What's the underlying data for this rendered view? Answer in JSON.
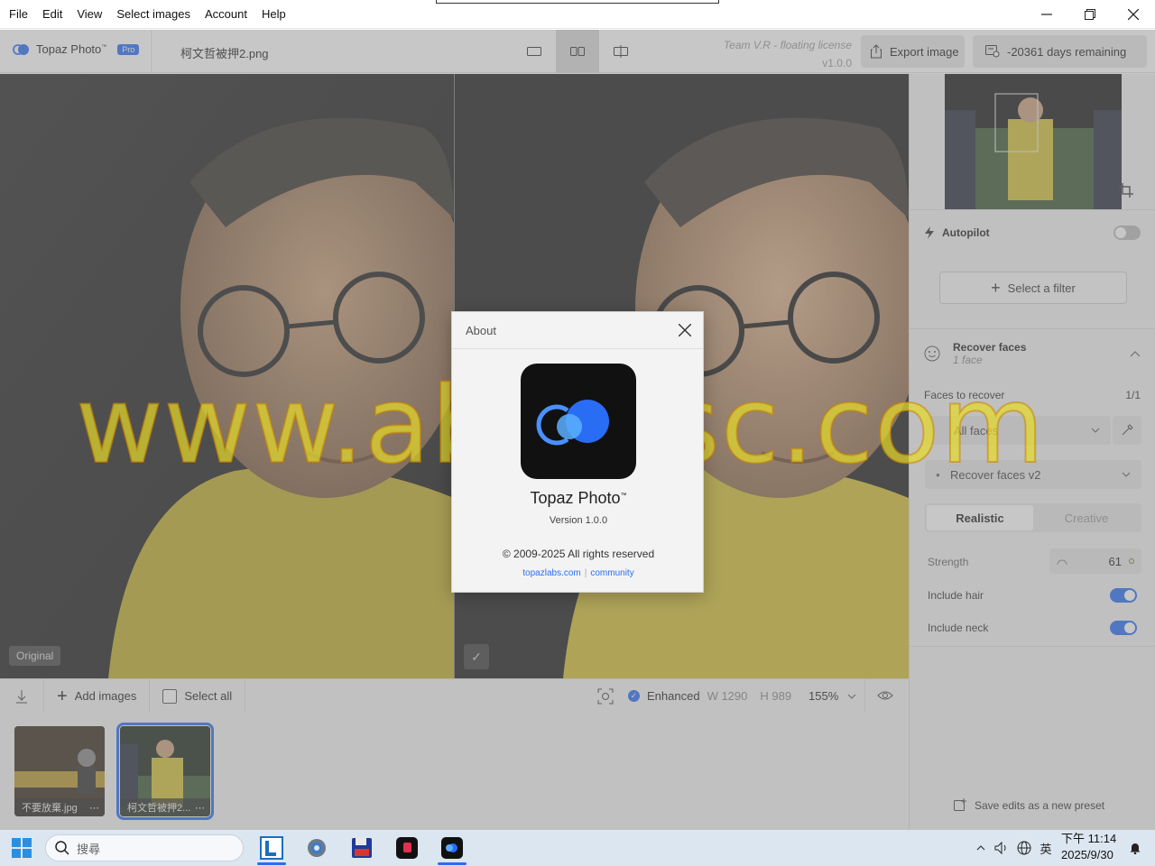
{
  "menu": [
    "File",
    "Edit",
    "View",
    "Select images",
    "Account",
    "Help"
  ],
  "header": {
    "brand_name": "Topaz Photo",
    "brand_tm": "™",
    "pro_badge": "Pro",
    "filename": "柯文哲被押2.png",
    "license_line": "Team V.R - floating license",
    "version": "v1.0.0",
    "export_label": "Export image",
    "days_label": "-20361 days remaining"
  },
  "panes": {
    "left_label": "Original",
    "right_check": "✓"
  },
  "sidebar": {
    "autopilot_label": "Autopilot",
    "autopilot_on": false,
    "select_filter_label": "Select a filter",
    "recover_title": "Recover faces",
    "recover_subtitle": "1 face",
    "faces_label": "Faces to recover",
    "faces_count": "1/1",
    "faces_dropdown": "All faces",
    "model_dropdown": "Recover faces v2",
    "seg_realistic": "Realistic",
    "seg_creative": "Creative",
    "strength_label": "Strength",
    "strength_value": "61",
    "include_hair_label": "Include hair",
    "include_hair_on": true,
    "include_neck_label": "Include neck",
    "include_neck_on": true,
    "save_preset_label": "Save edits as a new preset"
  },
  "bottombar": {
    "add_images": "Add images",
    "select_all": "Select all",
    "enhanced_label": "Enhanced",
    "width": "W 1290",
    "height": "H 989",
    "zoom": "155%"
  },
  "filmstrip": [
    {
      "name": "不要放棄.jpg",
      "selected": false
    },
    {
      "name": "柯文哲被押2...",
      "selected": true
    }
  ],
  "about": {
    "title": "About",
    "app_name": "Topaz Photo",
    "app_tm": "™",
    "version": "Version 1.0.0",
    "copyright": "© 2009-2025 All rights reserved",
    "link1": "topazlabs.com",
    "link_sep": "|",
    "link2": "community"
  },
  "watermark": "www.abodisc.com",
  "taskbar": {
    "search_placeholder": "搜尋",
    "ime": "英",
    "time": "下午 11:14",
    "date": "2025/9/30"
  },
  "colors": {
    "accent": "#2a6df5",
    "watermark_fill": "#e6dc28",
    "shirt": "#d8c23a"
  }
}
